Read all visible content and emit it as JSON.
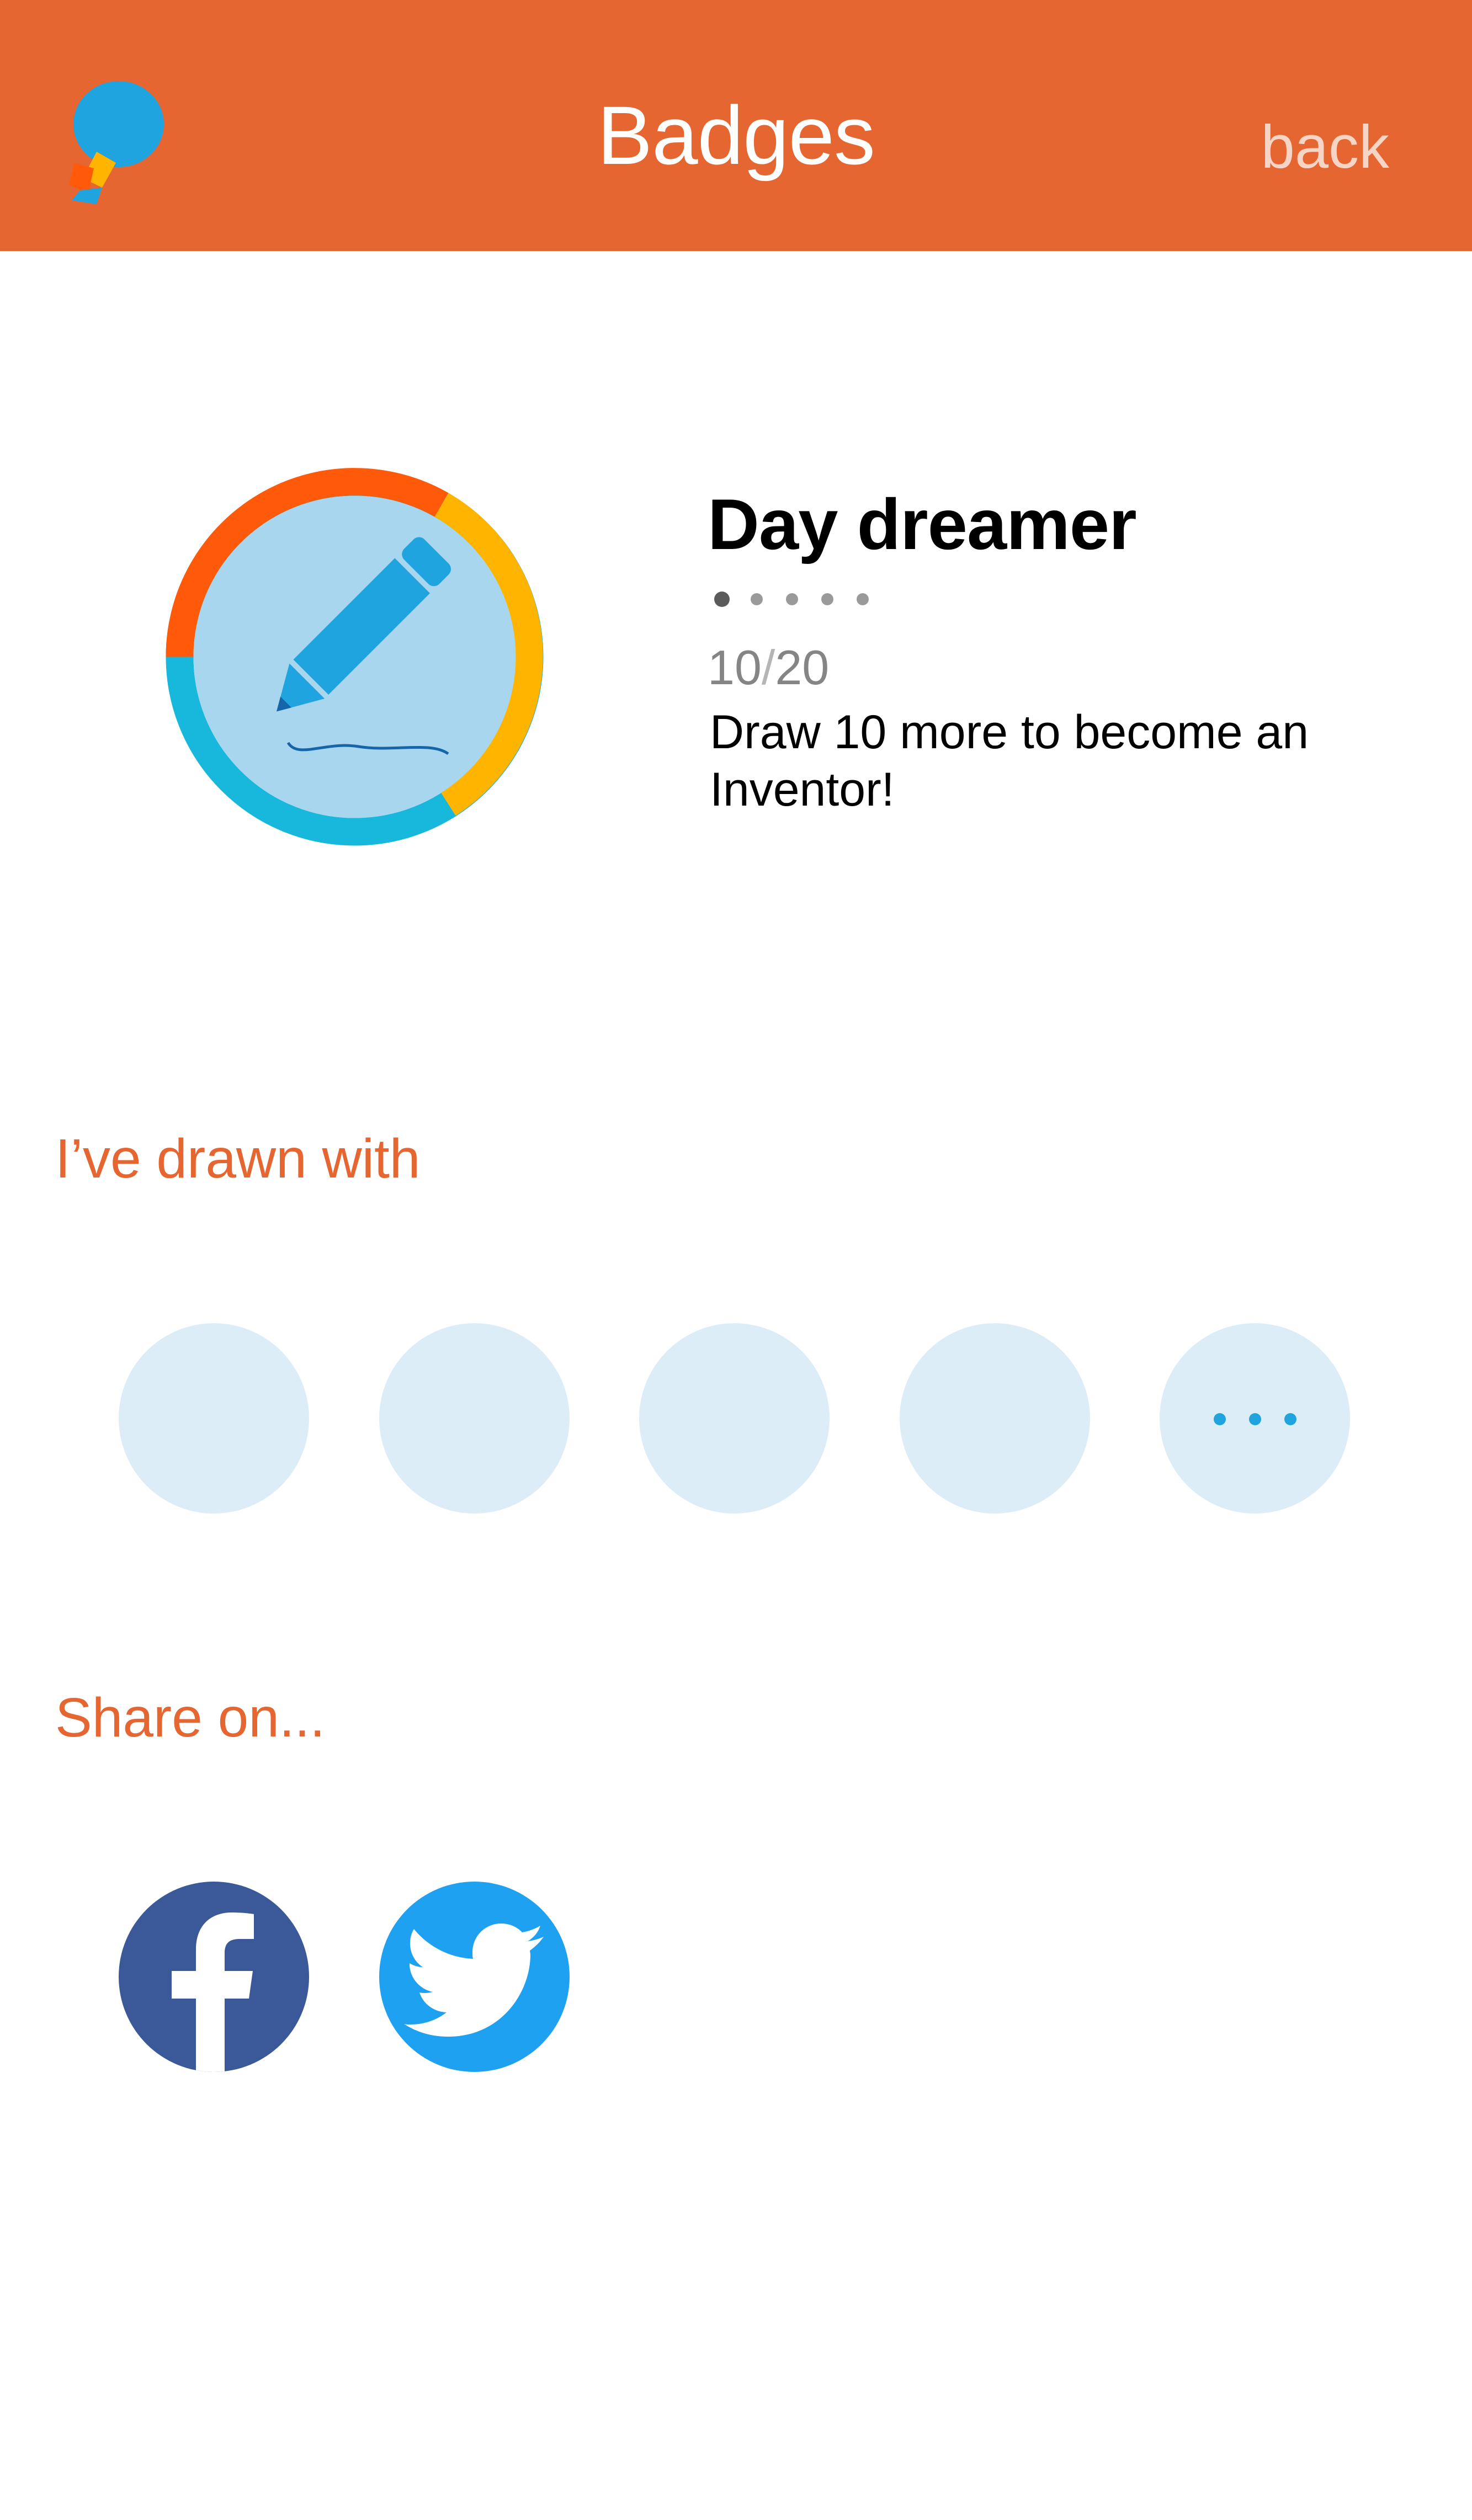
{
  "header": {
    "title": "Badges",
    "back_label": "back",
    "background_color": "#E56631",
    "logo_icon": "balloon-logo-icon"
  },
  "badge": {
    "name": "Day dreamer",
    "icon": "pencil-icon",
    "level_total": 5,
    "level_current": 1,
    "progress_current": "10",
    "progress_separator": "/",
    "progress_goal": "20",
    "description": "Draw 10 more to become an Inventor!",
    "ring_colors": [
      "#FF5A0A",
      "#FFB400",
      "#17B8DC"
    ],
    "inner_color": "#A7D6EE"
  },
  "drawn_with": {
    "heading": "I’ve drawn with",
    "friend_count": 4,
    "more_icon": "ellipsis-icon"
  },
  "share": {
    "heading": "Share on...",
    "networks": [
      {
        "name": "facebook",
        "icon": "facebook-icon",
        "color": "#3B5998"
      },
      {
        "name": "twitter",
        "icon": "twitter-icon",
        "color": "#1FA1F1"
      }
    ]
  }
}
